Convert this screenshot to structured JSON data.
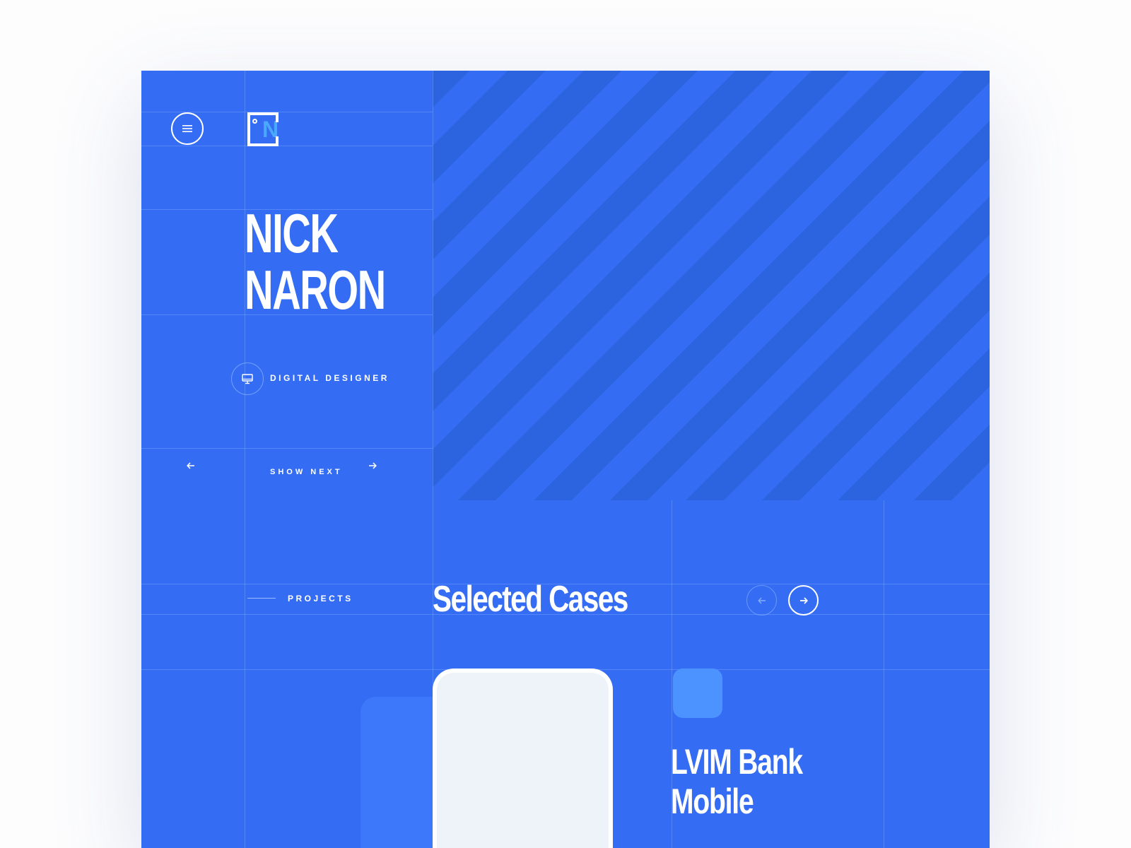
{
  "hero": {
    "name_line1": "NICK",
    "name_line2": "NARON",
    "role": "DIGITAL DESIGNER",
    "show_next_label": "SHOW NEXT"
  },
  "projects": {
    "label": "PROJECTS",
    "title": "Selected Cases",
    "case": {
      "title_line1": "LVIM Bank",
      "title_line2": "Mobile"
    }
  },
  "icons": {
    "menu": "hamburger-icon",
    "logo": "NN-logo",
    "role": "monitor-icon",
    "prev": "arrow-left-icon",
    "next": "arrow-right-icon"
  },
  "colors": {
    "background": "#346df4",
    "stripe": "#2c63de",
    "accent": "#4c93ff",
    "logo_accent": "#4aa8ff",
    "phone_screen": "#eef3f9"
  }
}
